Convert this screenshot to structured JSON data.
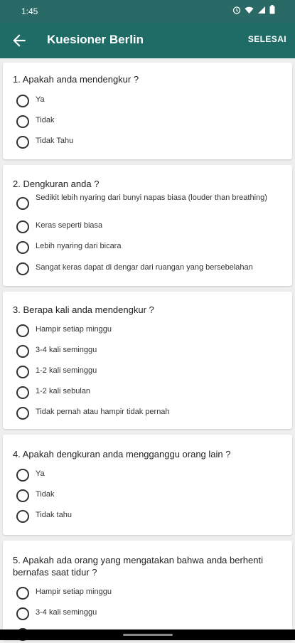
{
  "status_bar": {
    "time": "1:45"
  },
  "appbar": {
    "title": "Kuesioner Berlin",
    "finish_label": "SELESAI"
  },
  "questions": [
    {
      "text": "1. Apakah anda mendengkur ?",
      "options": [
        "Ya",
        "Tidak",
        "Tidak Tahu"
      ]
    },
    {
      "text": "2. Dengkuran anda ?",
      "options": [
        "Sedikit lebih nyaring dari bunyi napas biasa (louder than breathing)",
        "Keras seperti biasa",
        "Lebih nyaring dari bicara",
        "Sangat keras dapat di dengar dari ruangan yang bersebelahan"
      ]
    },
    {
      "text": "3. Berapa kali anda mendengkur ?",
      "options": [
        "Hampir setiap minggu",
        "3-4 kali seminggu",
        "1-2 kali seminggu",
        "1-2 kali sebulan",
        "Tidak pernah atau hampir tidak pernah"
      ]
    },
    {
      "text": "4. Apakah dengkuran anda mengganggu orang lain ?",
      "options": [
        "Ya",
        "Tidak",
        "Tidak tahu"
      ]
    },
    {
      "text": "5. Apakah ada orang yang mengatakan bahwa anda berhenti bernafas saat tidur ?",
      "options": [
        "Hampir setiap minggu",
        "3-4 kali seminggu"
      ]
    }
  ]
}
